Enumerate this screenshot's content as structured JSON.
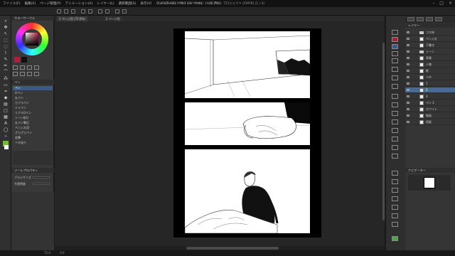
{
  "menubar": {
    "items": [
      "ファイル(F)",
      "編集(E)",
      "ページ管理(P)",
      "アニメーション(A)",
      "レイヤー(L)",
      "選択範囲(S)",
      "表示(V)",
      "フィルター(I)",
      "ウィンドウ(W)",
      "ヘルプ(H)"
    ],
    "document_title": "CLIP STUDIO PAINT EX - ページ 1 (72.0%) - プロジェクト [CMYK] (1 / 4)"
  },
  "tabs": [
    {
      "label": "1 ページ目 (72.0%)"
    },
    {
      "label": "2 ページ目"
    }
  ],
  "left_panel": {
    "color_header": "カラーサークル",
    "tool_header": "ペン",
    "brushes": [
      "ペン",
      "Gペン",
      "丸ペン",
      "カブラペン",
      "ミリペン",
      "リアルGペン",
      "トーン削り",
      "丸ペン筆圧",
      "ペン入れ用",
      "ざらざらペン",
      "毛筆",
      "ベタ塗り"
    ],
    "selected_brush": "ペン",
    "props_header": "ツールプロパティ",
    "prop_size_label": "ブラシサイズ",
    "prop_size_value": "12",
    "prop_opacity_label": "不透明度",
    "prop_opacity_value": "100"
  },
  "layers_panel": {
    "header": "レイヤー",
    "layers": [
      {
        "name": "コマ枠",
        "type": "folder"
      },
      {
        "name": "ペン入れ",
        "type": "layer"
      },
      {
        "name": "下書き",
        "type": "layer"
      },
      {
        "name": "トーン",
        "type": "folder"
      },
      {
        "name": "背景",
        "type": "layer"
      },
      {
        "name": "人物",
        "type": "layer"
      },
      {
        "name": "影",
        "type": "layer"
      },
      {
        "name": "ベタ",
        "type": "layer"
      },
      {
        "name": "1",
        "type": "layer"
      },
      {
        "name": "2",
        "type": "layer"
      },
      {
        "name": "3",
        "type": "layer"
      },
      {
        "name": "ペン 2",
        "type": "layer"
      },
      {
        "name": "ホワイト",
        "type": "layer"
      },
      {
        "name": "線画",
        "type": "layer"
      },
      {
        "name": "用紙",
        "type": "layer"
      }
    ],
    "selected_index": 9,
    "nav_label": "ナビゲーター"
  },
  "status": {
    "zoom": "72.0",
    "rotation": "0.0"
  },
  "colors": {
    "main_color": "#b01e3a",
    "accent": "#4a6a96",
    "swatch_green": "#6fbf30"
  }
}
